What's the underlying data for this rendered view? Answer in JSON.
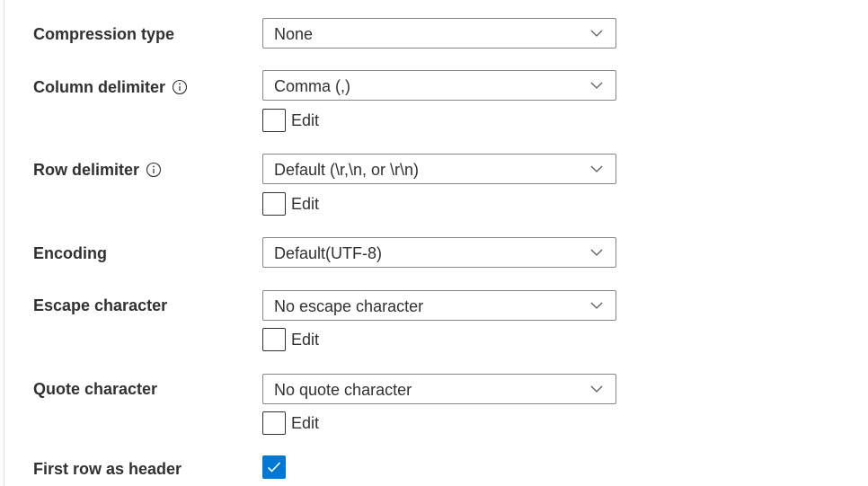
{
  "fields": [
    {
      "label": "Compression type",
      "value": "None",
      "has_info": false,
      "has_edit": false
    },
    {
      "label": "Column delimiter",
      "value": "Comma (,)",
      "has_info": true,
      "has_edit": true
    },
    {
      "label": "Row delimiter",
      "value": "Default (\\r,\\n, or \\r\\n)",
      "has_info": true,
      "has_edit": true
    },
    {
      "label": "Encoding",
      "value": "Default(UTF-8)",
      "has_info": false,
      "has_edit": false
    },
    {
      "label": "Escape character",
      "value": "No escape character",
      "has_info": false,
      "has_edit": true
    },
    {
      "label": "Quote character",
      "value": "No quote character",
      "has_info": false,
      "has_edit": true
    }
  ],
  "edit_label": "Edit",
  "first_row_header": {
    "label": "First row as header",
    "checked": true
  },
  "colors": {
    "accent": "#0078d4",
    "text": "#323130",
    "border": "#8a8886"
  }
}
